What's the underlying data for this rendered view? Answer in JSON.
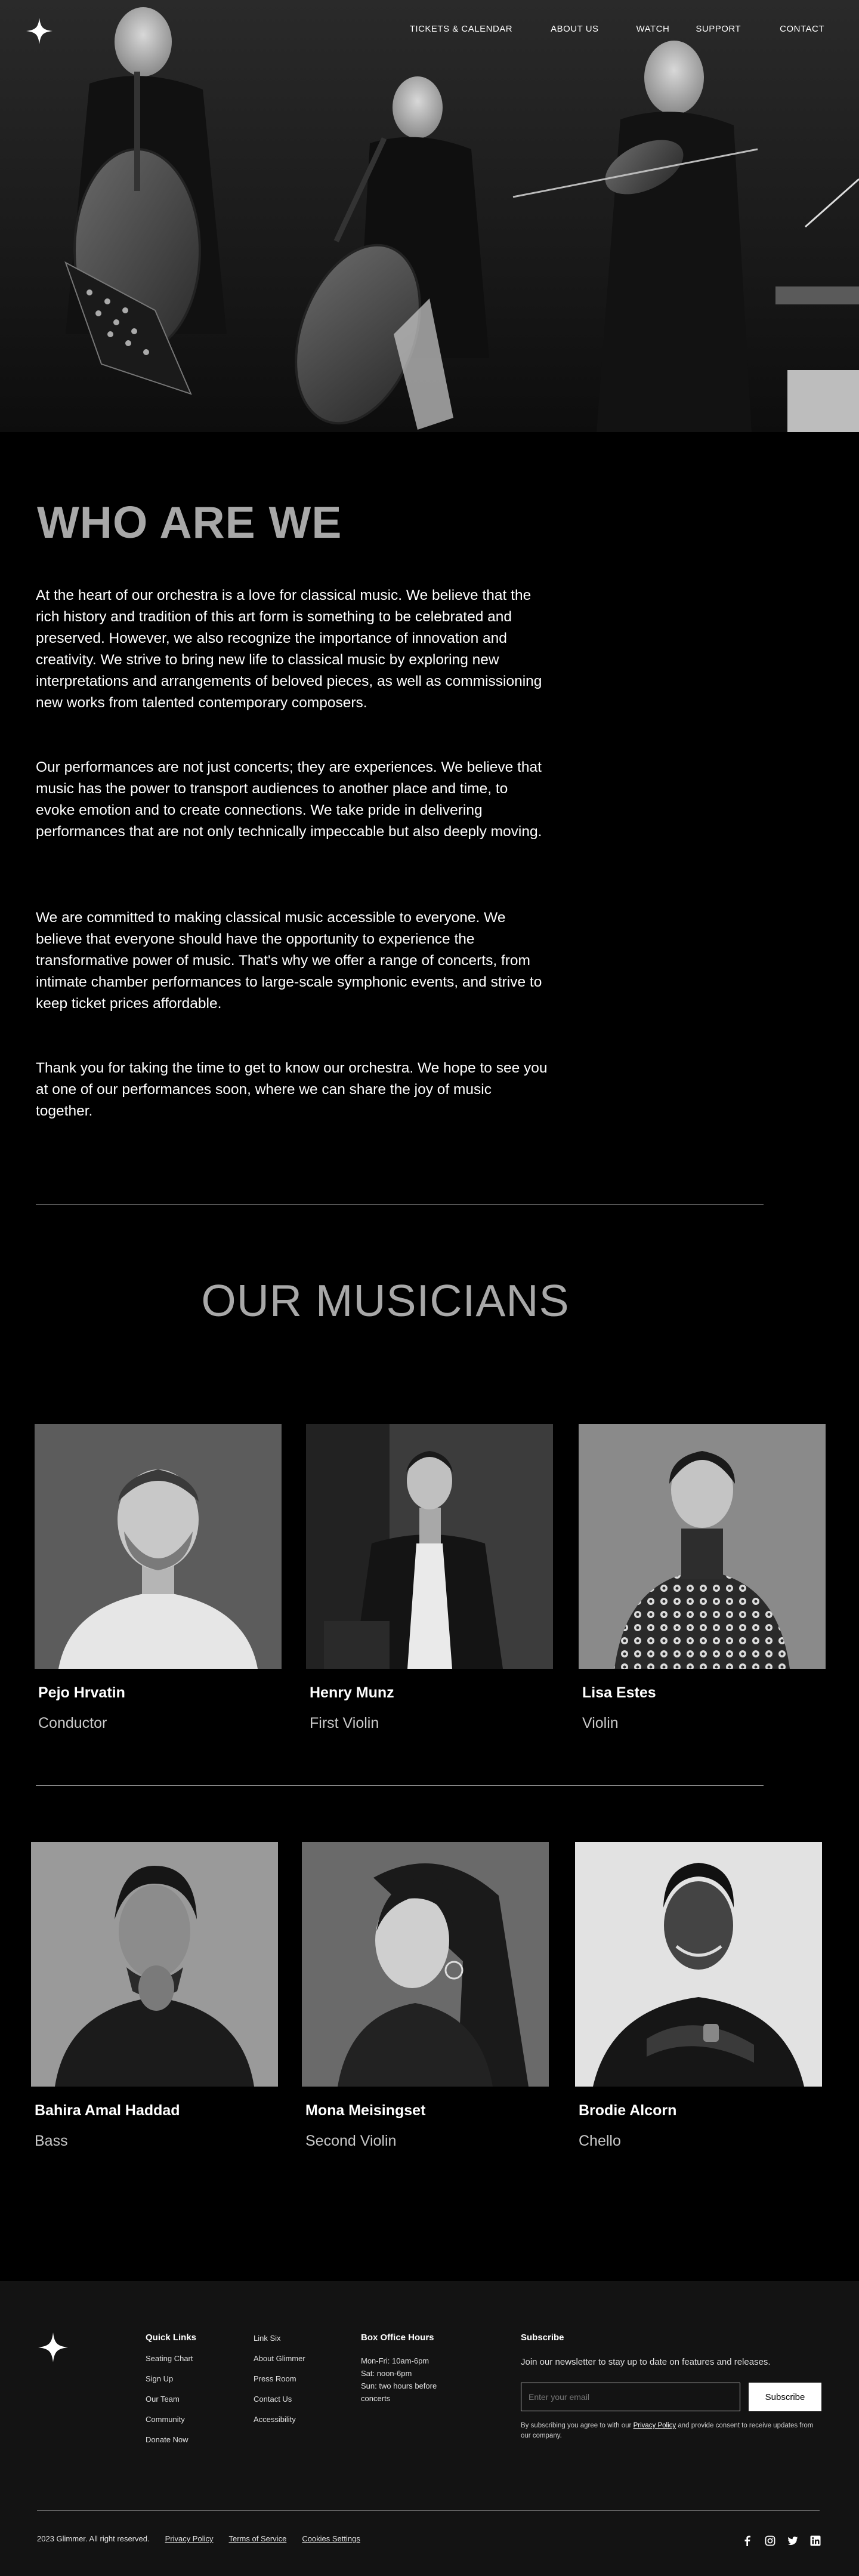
{
  "nav": {
    "items": [
      "TICKETS & CALENDAR",
      "ABOUT US",
      "WATCH",
      "SUPPORT",
      "CONTACT"
    ]
  },
  "logo_icon": "four-point-star-icon",
  "who": {
    "title": "WHO ARE WE",
    "paragraphs": [
      "At the heart of our orchestra is a love for classical music. We believe that the rich history and tradition of this art form is something to be celebrated and preserved. However, we also recognize the importance of innovation and creativity. We strive to bring new life to classical music by exploring new interpretations and arrangements of beloved pieces, as well as commissioning new works from talented contemporary composers.",
      "Our performances are not just concerts; they are experiences. We believe that music has the power to transport audiences to another place and time, to evoke emotion and to create connections. We take pride in delivering performances that are not only technically impeccable but also deeply moving.",
      "We are committed to making classical music accessible to everyone. We believe that everyone should have the opportunity to experience the transformative power of music. That's why we offer a range of concerts, from intimate chamber performances to large-scale symphonic events, and strive to keep ticket prices affordable.",
      "Thank you for taking the time to get to know our orchestra. We hope to see you at one of our performances soon, where we can share the joy of music together."
    ]
  },
  "musicians": {
    "title": "OUR MUSICIANS",
    "list": [
      {
        "name": "Pejo Hrvatin",
        "role": "Conductor"
      },
      {
        "name": "Henry Munz",
        "role": "First Violin"
      },
      {
        "name": "Lisa Estes",
        "role": "Violin"
      },
      {
        "name": "Bahira Amal Haddad",
        "role": "Bass"
      },
      {
        "name": "Mona Meisingset",
        "role": "Second Violin"
      },
      {
        "name": "Brodie Alcorn",
        "role": "Chello"
      }
    ]
  },
  "footer": {
    "quick_links": {
      "heading": "Quick Links",
      "items": [
        "Seating Chart",
        "Sign Up",
        "Our Team",
        "Community",
        "Donate Now"
      ]
    },
    "links_col2": [
      "Link Six",
      "About Glimmer",
      "Press Room",
      "Contact Us",
      "Accessibility"
    ],
    "box_office": {
      "heading": "Box Office Hours",
      "text": "Mon-Fri: 10am-6pm\nSat: noon-6pm\nSun: two hours before concerts"
    },
    "subscribe": {
      "heading": "Subscribe",
      "text": "Join our newsletter to stay up to date on features and releases.",
      "placeholder": "Enter your email",
      "button": "Subscribe",
      "note_pre": "By subscribing you agree to with our ",
      "note_link": "Privacy Policy",
      "note_post": " and provide consent to receive updates from our company."
    },
    "copyright": "2023 Glimmer. All right reserved.",
    "legal_links": [
      "Privacy Policy",
      "Terms of Service",
      "Cookies Settings"
    ],
    "socials": [
      "facebook-icon",
      "instagram-icon",
      "twitter-icon",
      "linkedin-icon"
    ]
  }
}
